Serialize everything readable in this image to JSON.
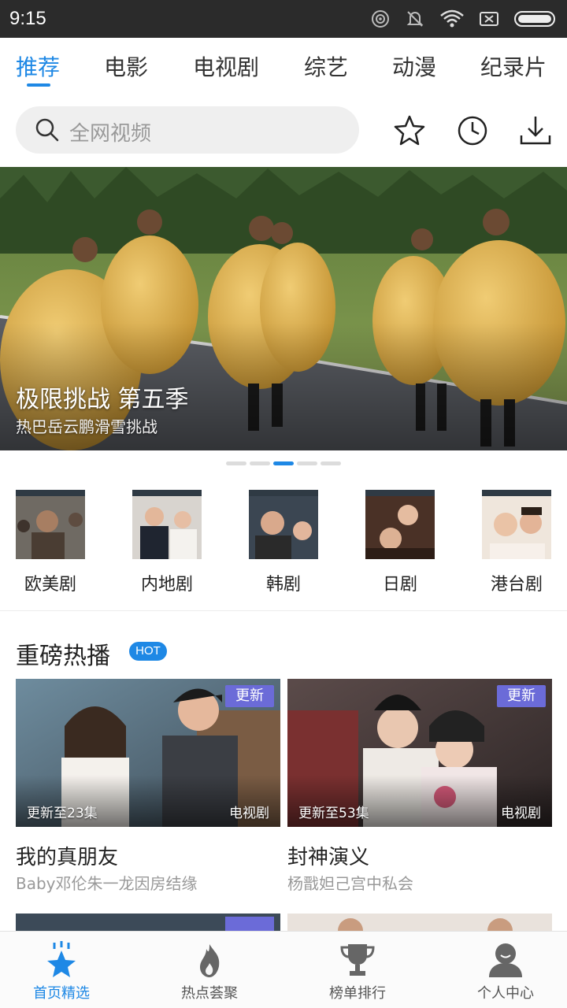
{
  "status_bar": {
    "time": "9:15",
    "icons": [
      "hotspot-icon",
      "mute-icon",
      "wifi-icon",
      "no-sim-icon",
      "battery-icon"
    ]
  },
  "category_tabs": [
    {
      "label": "推荐",
      "active": true
    },
    {
      "label": "电影",
      "active": false
    },
    {
      "label": "电视剧",
      "active": false
    },
    {
      "label": "综艺",
      "active": false
    },
    {
      "label": "动漫",
      "active": false
    },
    {
      "label": "纪录片",
      "active": false
    }
  ],
  "search": {
    "placeholder": "全网视频"
  },
  "toolbar_icons": [
    "star-icon",
    "history-icon",
    "download-icon"
  ],
  "banner": {
    "title": "极限挑战 第五季",
    "subtitle": "热巴岳云鹏滑雪挑战",
    "page_count": 5,
    "active_page": 3
  },
  "genres": [
    {
      "label": "欧美剧"
    },
    {
      "label": "内地剧"
    },
    {
      "label": "韩剧"
    },
    {
      "label": "日剧"
    },
    {
      "label": "港台剧"
    }
  ],
  "section": {
    "title": "重磅热播",
    "badge": "HOT"
  },
  "cards": [
    {
      "badge": "更新",
      "episode": "更新至23集",
      "type": "电视剧",
      "title": "我的真朋友",
      "subtitle": "Baby邓伦朱一龙因房结缘"
    },
    {
      "badge": "更新",
      "episode": "更新至53集",
      "type": "电视剧",
      "title": "封神演义",
      "subtitle": "杨戬妲己宫中私会"
    }
  ],
  "bottom_nav": [
    {
      "label": "首页精选",
      "icon": "star-home-icon",
      "active": true
    },
    {
      "label": "热点荟聚",
      "icon": "flame-icon",
      "active": false
    },
    {
      "label": "榜单排行",
      "icon": "trophy-icon",
      "active": false
    },
    {
      "label": "个人中心",
      "icon": "person-icon",
      "active": false
    }
  ],
  "colors": {
    "accent": "#1e88e5",
    "badge_update": "#6b6bd8",
    "status_bar": "#2b2b2b"
  }
}
